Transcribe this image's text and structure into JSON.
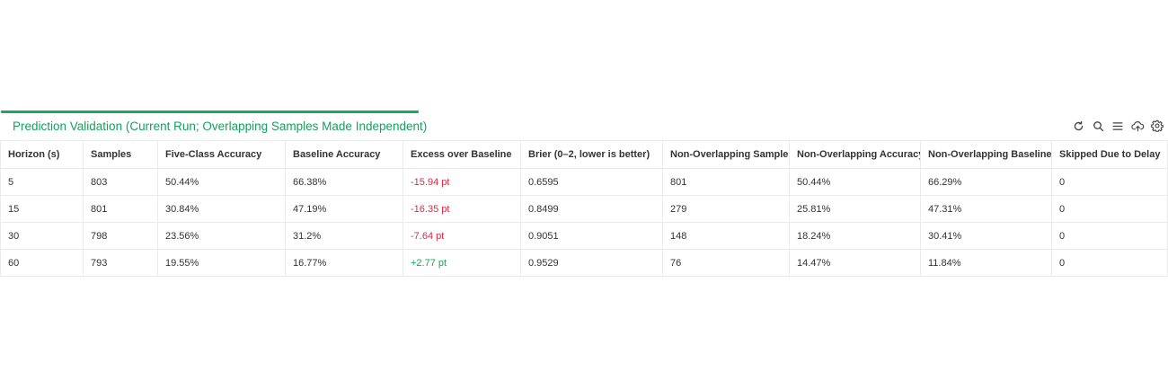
{
  "panel": {
    "title": "Prediction Validation (Current Run; Overlapping Samples Made Independent)",
    "toolbar": [
      {
        "name": "refresh-icon"
      },
      {
        "name": "search-icon"
      },
      {
        "name": "menu-icon"
      },
      {
        "name": "cloud-upload-icon"
      },
      {
        "name": "gear-icon"
      }
    ]
  },
  "colors": {
    "accent": "#15a05f",
    "negative": "#e0283f",
    "positive": "#16a35e"
  },
  "table": {
    "columns": [
      "Horizon (s)",
      "Samples",
      "Five-Class Accuracy",
      "Baseline Accuracy",
      "Excess over Baseline",
      "Brier (0–2,  lower is better)",
      "Non-Overlapping Samples",
      "Non-Overlapping Accuracy",
      "Non-Overlapping Baseline",
      "Skipped Due to Delay"
    ],
    "rows": [
      [
        "5",
        "803",
        "50.44%",
        "66.38%",
        "-15.94 pt",
        "0.6595",
        "801",
        "50.44%",
        "66.29%",
        "0"
      ],
      [
        "15",
        "801",
        "30.84%",
        "47.19%",
        "-16.35 pt",
        "0.8499",
        "279",
        "25.81%",
        "47.31%",
        "0"
      ],
      [
        "30",
        "798",
        "23.56%",
        "31.2%",
        "-7.64 pt",
        "0.9051",
        "148",
        "18.24%",
        "30.41%",
        "0"
      ],
      [
        "60",
        "793",
        "19.55%",
        "16.77%",
        "+2.77 pt",
        "0.9529",
        "76",
        "14.47%",
        "11.84%",
        "0"
      ]
    ]
  }
}
